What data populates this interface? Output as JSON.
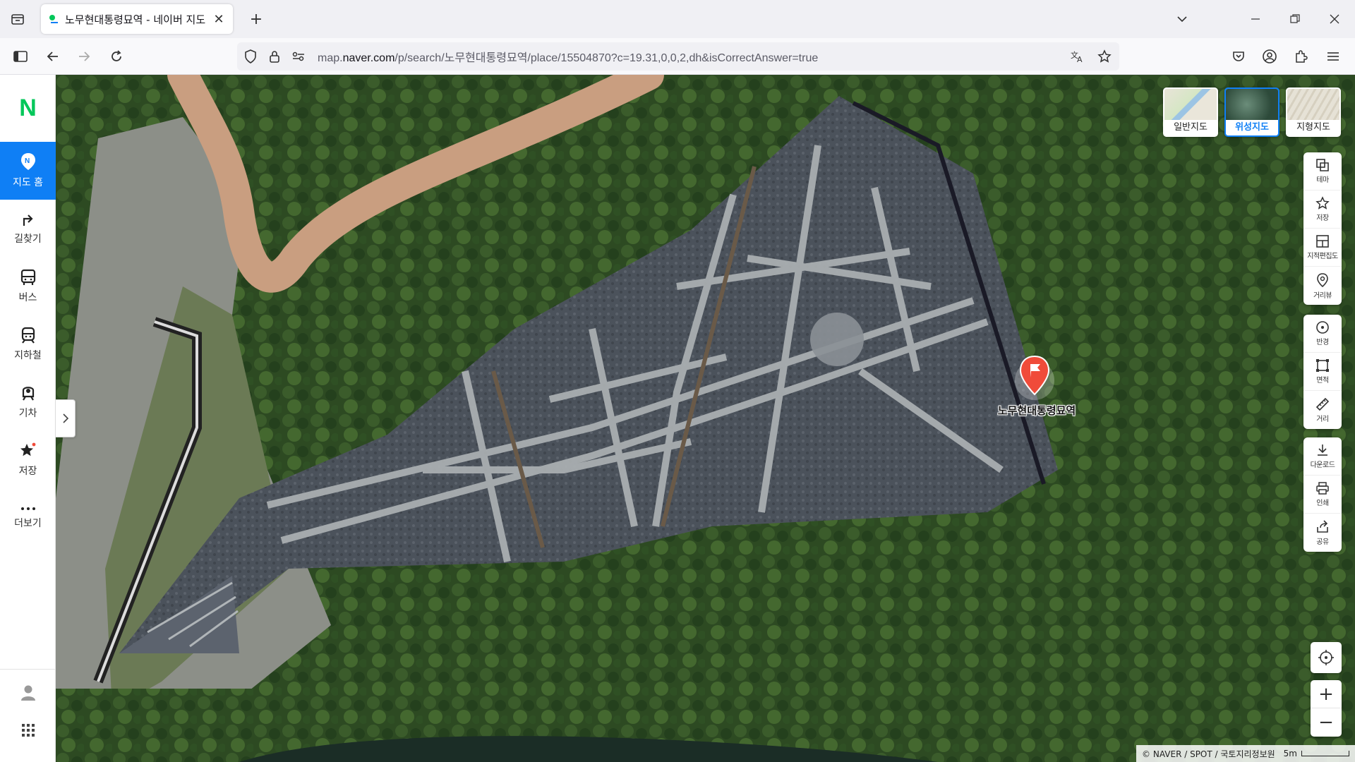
{
  "browser": {
    "tab_title": "노무현대통령묘역 - 네이버 지도",
    "url_prefix": "map.",
    "url_domain": "naver.com",
    "url_path": "/p/search/노무현대통령묘역/place/15504870?c=19.31,0,0,2,dh&isCorrectAnswer=true"
  },
  "sidebar": {
    "logo": "N",
    "items": [
      {
        "label": "지도 홈",
        "icon": "map-pin-icon"
      },
      {
        "label": "길찾기",
        "icon": "directions-arrow-icon"
      },
      {
        "label": "버스",
        "icon": "bus-icon"
      },
      {
        "label": "지하철",
        "icon": "subway-icon"
      },
      {
        "label": "기차",
        "icon": "train-icon"
      },
      {
        "label": "저장",
        "icon": "star-icon"
      },
      {
        "label": "더보기",
        "icon": "more-dots-icon"
      }
    ]
  },
  "map": {
    "marker_label": "노무현대통령묘역",
    "map_types": [
      {
        "label": "일반지도",
        "selected": false
      },
      {
        "label": "위성지도",
        "selected": true
      },
      {
        "label": "지형지도",
        "selected": false
      }
    ],
    "tools_group1": [
      "테마",
      "저장",
      "지적편집도",
      "거리뷰"
    ],
    "tools_group2": [
      "반경",
      "면적",
      "거리"
    ],
    "tools_group3": [
      "다운로드",
      "인쇄",
      "공유"
    ],
    "zoom_in": "+",
    "zoom_out": "−",
    "attribution": "© NAVER / SPOT / 국토지리정보원",
    "scale": "5m"
  },
  "colors": {
    "accent": "#0f7ff5",
    "naver_green": "#03c75a",
    "marker_red": "#f04b3a"
  }
}
